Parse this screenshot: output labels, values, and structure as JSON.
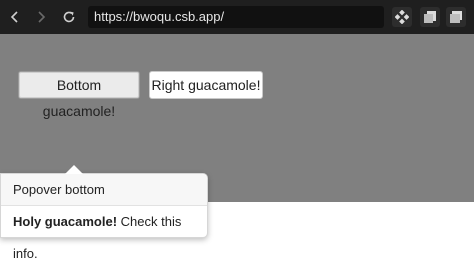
{
  "browser": {
    "url": "https://bwoqu.csb.app/",
    "nav_icons": [
      "back-icon",
      "forward-icon",
      "reload-icon"
    ],
    "toolbar_icons": [
      "extension-icon",
      "copy-icon",
      "tabs-icon"
    ],
    "colors": {
      "topbar": "#1f1f1f",
      "urlbar": "#111111"
    }
  },
  "page": {
    "background": "#808080",
    "buttons": [
      {
        "label": "Bottom guacamole!",
        "state": "active"
      },
      {
        "label": "Right guacamole!",
        "state": "default"
      }
    ]
  },
  "popover": {
    "title": "Popover bottom",
    "body_bold": "Holy guacamole!",
    "body_rest": " Check this info."
  }
}
